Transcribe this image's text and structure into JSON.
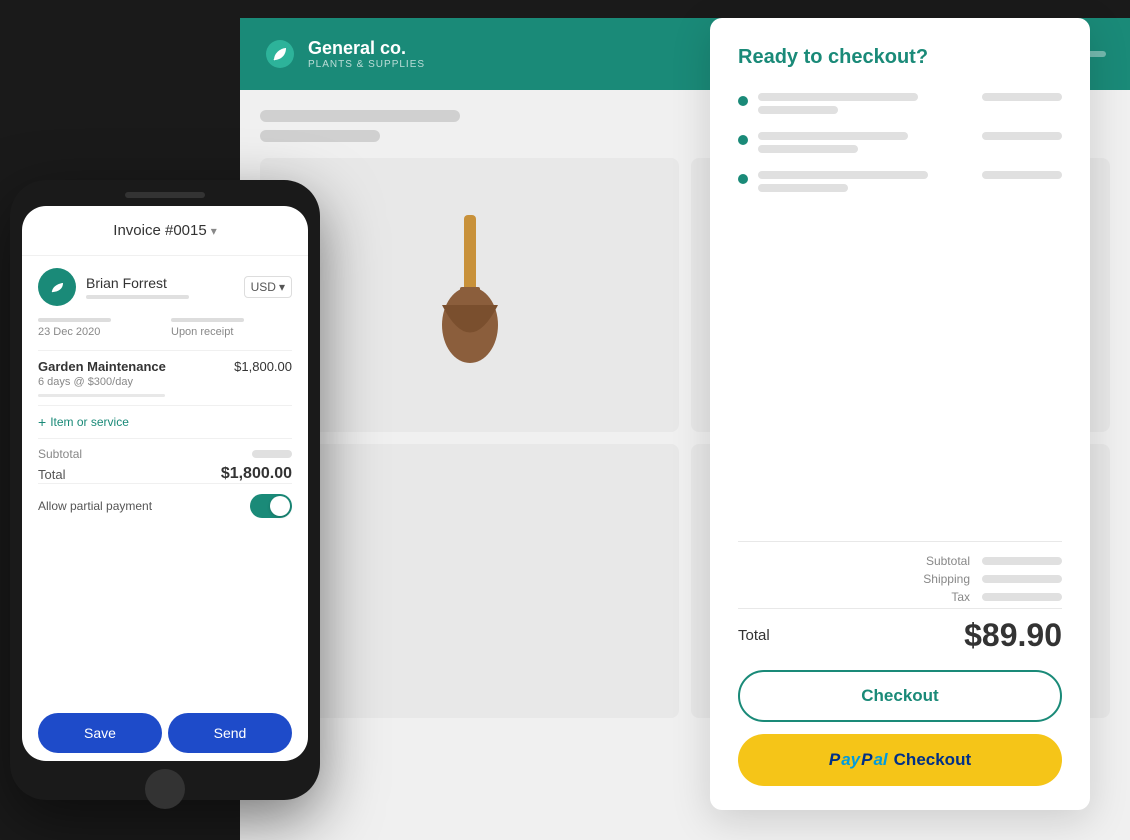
{
  "background": {
    "color": "#1a1a1a"
  },
  "header": {
    "company_name": "General co.",
    "company_sub": "PLANTS & SUPPLIES",
    "color": "#1a8a78"
  },
  "phone": {
    "invoice_title": "Invoice #0015",
    "client_name": "Brian Forrest",
    "currency": "USD",
    "date_from": "23 Dec 2020",
    "date_due": "Upon receipt",
    "line_item_name": "Garden Maintenance",
    "line_item_price": "$1,800.00",
    "line_item_desc": "6 days @ $300/day",
    "add_item_label": "Item or service",
    "subtotal_label": "Subtotal",
    "total_label": "Total",
    "total_amount": "$1,800.00",
    "partial_payment_label": "Allow partial payment",
    "save_btn": "Save",
    "send_btn": "Send"
  },
  "checkout": {
    "title": "Ready to checkout?",
    "total_label": "Total",
    "total_amount": "$89.90",
    "subtotal_label": "Subtotal",
    "shipping_label": "Shipping",
    "tax_label": "Tax",
    "checkout_btn": "Checkout",
    "paypal_btn_text": "Checkout",
    "paypal_label": "PayPal"
  }
}
